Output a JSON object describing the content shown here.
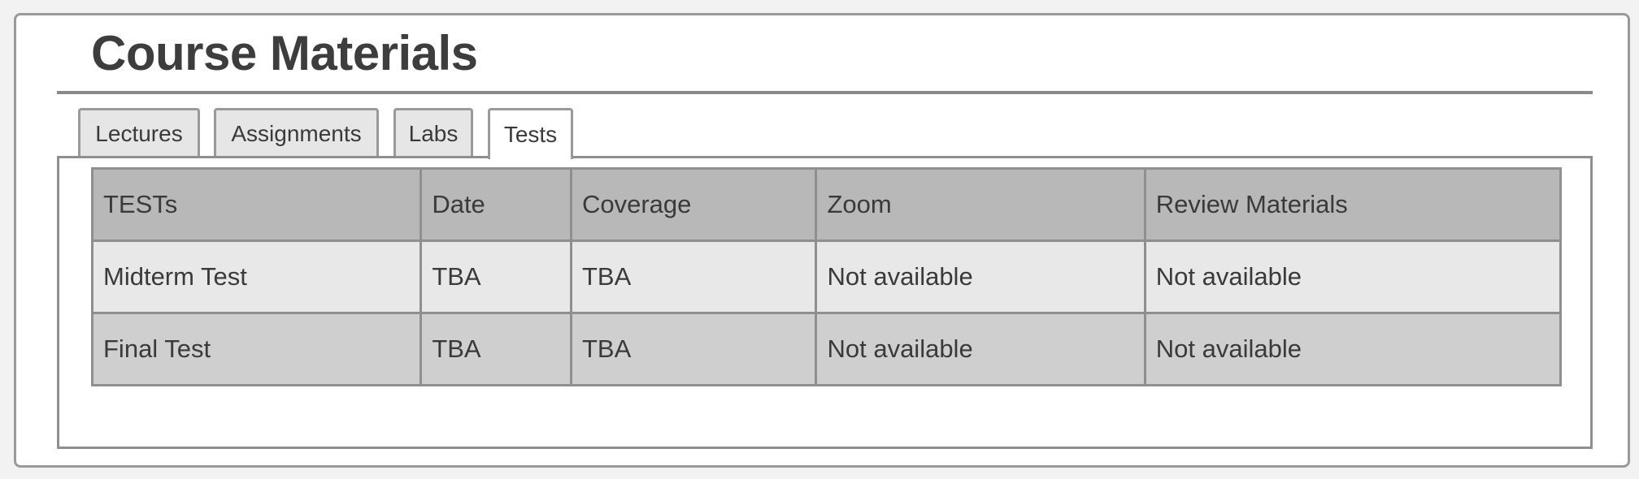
{
  "page": {
    "title": "Course Materials"
  },
  "tabs": [
    {
      "label": "Lectures",
      "active": false
    },
    {
      "label": "Assignments",
      "active": false
    },
    {
      "label": "Labs",
      "active": false
    },
    {
      "label": "Tests",
      "active": true
    }
  ],
  "table": {
    "headers": [
      "TESTs",
      "Date",
      "Coverage",
      "Zoom",
      "Review Materials"
    ],
    "rows": [
      [
        "Midterm Test",
        "TBA",
        "TBA",
        "Not available",
        "Not available"
      ],
      [
        "Final Test",
        "TBA",
        "TBA",
        "Not available",
        "Not available"
      ]
    ]
  },
  "colors": {
    "header_bg": "#b8b8b8",
    "row_light": "#e8e8e8",
    "row_dark": "#cfcfcf",
    "border": "#8f8f8f",
    "text": "#3a3a3a"
  }
}
